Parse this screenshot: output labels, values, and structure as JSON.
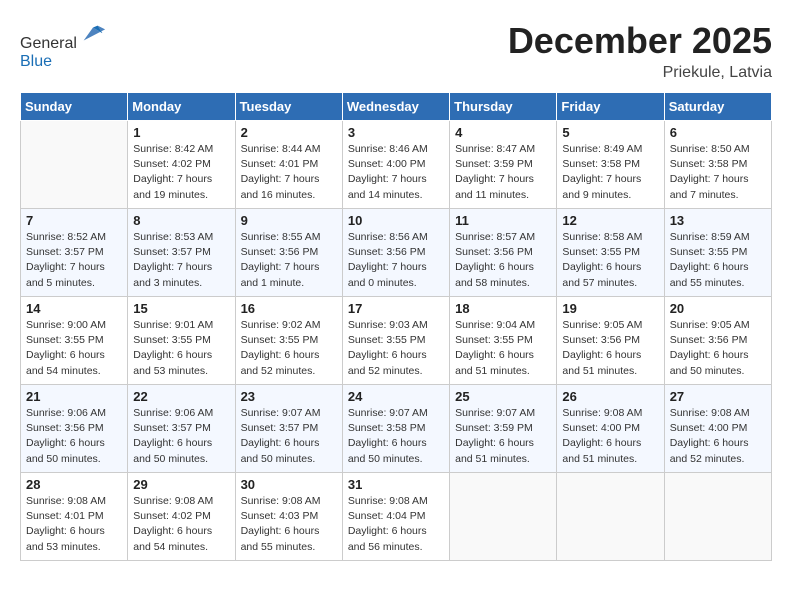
{
  "header": {
    "logo_line1": "General",
    "logo_line2": "Blue",
    "month_year": "December 2025",
    "location": "Priekule, Latvia"
  },
  "weekdays": [
    "Sunday",
    "Monday",
    "Tuesday",
    "Wednesday",
    "Thursday",
    "Friday",
    "Saturday"
  ],
  "weeks": [
    [
      {
        "day": "",
        "sunrise": "",
        "sunset": "",
        "daylight": ""
      },
      {
        "day": "1",
        "sunrise": "8:42 AM",
        "sunset": "4:02 PM",
        "daylight": "7 hours and 19 minutes."
      },
      {
        "day": "2",
        "sunrise": "8:44 AM",
        "sunset": "4:01 PM",
        "daylight": "7 hours and 16 minutes."
      },
      {
        "day": "3",
        "sunrise": "8:46 AM",
        "sunset": "4:00 PM",
        "daylight": "7 hours and 14 minutes."
      },
      {
        "day": "4",
        "sunrise": "8:47 AM",
        "sunset": "3:59 PM",
        "daylight": "7 hours and 11 minutes."
      },
      {
        "day": "5",
        "sunrise": "8:49 AM",
        "sunset": "3:58 PM",
        "daylight": "7 hours and 9 minutes."
      },
      {
        "day": "6",
        "sunrise": "8:50 AM",
        "sunset": "3:58 PM",
        "daylight": "7 hours and 7 minutes."
      }
    ],
    [
      {
        "day": "7",
        "sunrise": "8:52 AM",
        "sunset": "3:57 PM",
        "daylight": "7 hours and 5 minutes."
      },
      {
        "day": "8",
        "sunrise": "8:53 AM",
        "sunset": "3:57 PM",
        "daylight": "7 hours and 3 minutes."
      },
      {
        "day": "9",
        "sunrise": "8:55 AM",
        "sunset": "3:56 PM",
        "daylight": "7 hours and 1 minute."
      },
      {
        "day": "10",
        "sunrise": "8:56 AM",
        "sunset": "3:56 PM",
        "daylight": "7 hours and 0 minutes."
      },
      {
        "day": "11",
        "sunrise": "8:57 AM",
        "sunset": "3:56 PM",
        "daylight": "6 hours and 58 minutes."
      },
      {
        "day": "12",
        "sunrise": "8:58 AM",
        "sunset": "3:55 PM",
        "daylight": "6 hours and 57 minutes."
      },
      {
        "day": "13",
        "sunrise": "8:59 AM",
        "sunset": "3:55 PM",
        "daylight": "6 hours and 55 minutes."
      }
    ],
    [
      {
        "day": "14",
        "sunrise": "9:00 AM",
        "sunset": "3:55 PM",
        "daylight": "6 hours and 54 minutes."
      },
      {
        "day": "15",
        "sunrise": "9:01 AM",
        "sunset": "3:55 PM",
        "daylight": "6 hours and 53 minutes."
      },
      {
        "day": "16",
        "sunrise": "9:02 AM",
        "sunset": "3:55 PM",
        "daylight": "6 hours and 52 minutes."
      },
      {
        "day": "17",
        "sunrise": "9:03 AM",
        "sunset": "3:55 PM",
        "daylight": "6 hours and 52 minutes."
      },
      {
        "day": "18",
        "sunrise": "9:04 AM",
        "sunset": "3:55 PM",
        "daylight": "6 hours and 51 minutes."
      },
      {
        "day": "19",
        "sunrise": "9:05 AM",
        "sunset": "3:56 PM",
        "daylight": "6 hours and 51 minutes."
      },
      {
        "day": "20",
        "sunrise": "9:05 AM",
        "sunset": "3:56 PM",
        "daylight": "6 hours and 50 minutes."
      }
    ],
    [
      {
        "day": "21",
        "sunrise": "9:06 AM",
        "sunset": "3:56 PM",
        "daylight": "6 hours and 50 minutes."
      },
      {
        "day": "22",
        "sunrise": "9:06 AM",
        "sunset": "3:57 PM",
        "daylight": "6 hours and 50 minutes."
      },
      {
        "day": "23",
        "sunrise": "9:07 AM",
        "sunset": "3:57 PM",
        "daylight": "6 hours and 50 minutes."
      },
      {
        "day": "24",
        "sunrise": "9:07 AM",
        "sunset": "3:58 PM",
        "daylight": "6 hours and 50 minutes."
      },
      {
        "day": "25",
        "sunrise": "9:07 AM",
        "sunset": "3:59 PM",
        "daylight": "6 hours and 51 minutes."
      },
      {
        "day": "26",
        "sunrise": "9:08 AM",
        "sunset": "4:00 PM",
        "daylight": "6 hours and 51 minutes."
      },
      {
        "day": "27",
        "sunrise": "9:08 AM",
        "sunset": "4:00 PM",
        "daylight": "6 hours and 52 minutes."
      }
    ],
    [
      {
        "day": "28",
        "sunrise": "9:08 AM",
        "sunset": "4:01 PM",
        "daylight": "6 hours and 53 minutes."
      },
      {
        "day": "29",
        "sunrise": "9:08 AM",
        "sunset": "4:02 PM",
        "daylight": "6 hours and 54 minutes."
      },
      {
        "day": "30",
        "sunrise": "9:08 AM",
        "sunset": "4:03 PM",
        "daylight": "6 hours and 55 minutes."
      },
      {
        "day": "31",
        "sunrise": "9:08 AM",
        "sunset": "4:04 PM",
        "daylight": "6 hours and 56 minutes."
      },
      {
        "day": "",
        "sunrise": "",
        "sunset": "",
        "daylight": ""
      },
      {
        "day": "",
        "sunrise": "",
        "sunset": "",
        "daylight": ""
      },
      {
        "day": "",
        "sunrise": "",
        "sunset": "",
        "daylight": ""
      }
    ]
  ]
}
